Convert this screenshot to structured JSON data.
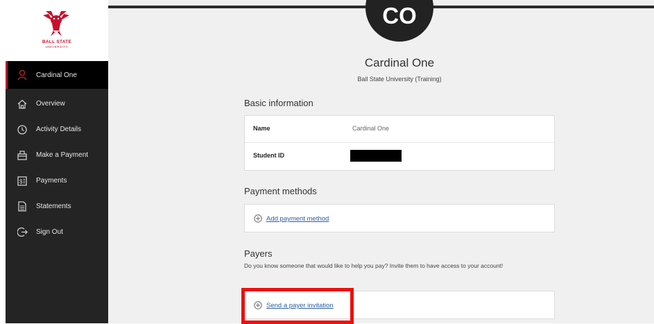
{
  "logo": {
    "line1": "BALL STATE",
    "line2": "UNIVERSITY"
  },
  "sidebar": {
    "items": [
      {
        "label": "Cardinal One",
        "icon": "user-icon",
        "active": true
      },
      {
        "label": "Overview",
        "icon": "home-icon"
      },
      {
        "label": "Activity Details",
        "icon": "clock-icon"
      },
      {
        "label": "Make a Payment",
        "icon": "payment-icon"
      },
      {
        "label": "Payments",
        "icon": "dollar-icon"
      },
      {
        "label": "Statements",
        "icon": "document-icon"
      },
      {
        "label": "Sign Out",
        "icon": "signout-icon"
      }
    ]
  },
  "profile": {
    "initials": "CO",
    "name": "Cardinal One",
    "institution": "Ball State University (Training)"
  },
  "basic_info": {
    "title": "Basic information",
    "rows": [
      {
        "label": "Name",
        "value": "Cardinal One"
      },
      {
        "label": "Student ID",
        "value": ""
      }
    ]
  },
  "payment_methods": {
    "title": "Payment methods",
    "add_link": "Add payment method"
  },
  "payers": {
    "title": "Payers",
    "description": "Do you know someone that would like to help you pay? Invite them to have access to your account!",
    "invite_link": "Send a payer invitation"
  },
  "colors": {
    "brand_red": "#b01f2e",
    "highlight_red": "#ef0d0d",
    "sidebar_bg": "#242424",
    "link_blue": "#2d5ea8"
  }
}
